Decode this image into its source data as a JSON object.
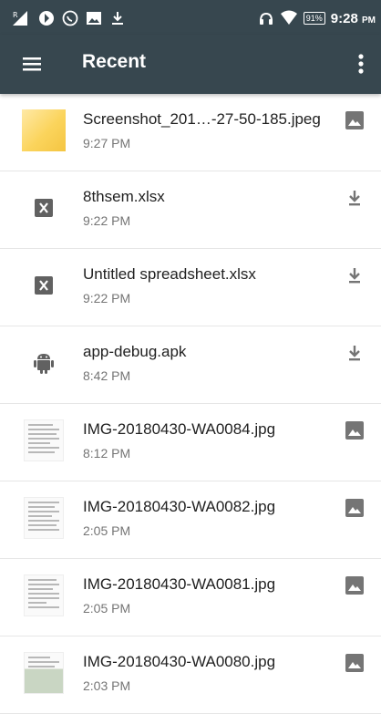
{
  "status_bar": {
    "time": "9:28",
    "ampm": "PM",
    "battery": "91%"
  },
  "app_bar": {
    "title": "Recent",
    "menu_icon": "hamburger-menu-icon",
    "overflow_icon": "more-vert-icon"
  },
  "files": [
    {
      "name": "Screenshot_201…-27-50-185.jpeg",
      "time": "9:27 PM",
      "thumb": "screenshot-thumbnail",
      "action": "image-icon"
    },
    {
      "name": "8thsem.xlsx",
      "time": "9:22 PM",
      "thumb": "spreadsheet-icon",
      "action": "download-icon"
    },
    {
      "name": "Untitled spreadsheet.xlsx",
      "time": "9:22 PM",
      "thumb": "spreadsheet-icon",
      "action": "download-icon"
    },
    {
      "name": "app-debug.apk",
      "time": "8:42 PM",
      "thumb": "android-icon",
      "action": "download-icon"
    },
    {
      "name": "IMG-20180430-WA0084.jpg",
      "time": "8:12 PM",
      "thumb": "document-thumbnail",
      "action": "image-icon"
    },
    {
      "name": "IMG-20180430-WA0082.jpg",
      "time": "2:05 PM",
      "thumb": "document-thumbnail",
      "action": "image-icon"
    },
    {
      "name": "IMG-20180430-WA0081.jpg",
      "time": "2:05 PM",
      "thumb": "document-thumbnail",
      "action": "image-icon"
    },
    {
      "name": "IMG-20180430-WA0080.jpg",
      "time": "2:03 PM",
      "thumb": "document-thumbnail",
      "action": "image-icon"
    }
  ],
  "colors": {
    "app_bar": "#37474f",
    "status_bar": "#37474f",
    "icon_gray": "#757575",
    "spreadsheet_icon": "#616161"
  }
}
